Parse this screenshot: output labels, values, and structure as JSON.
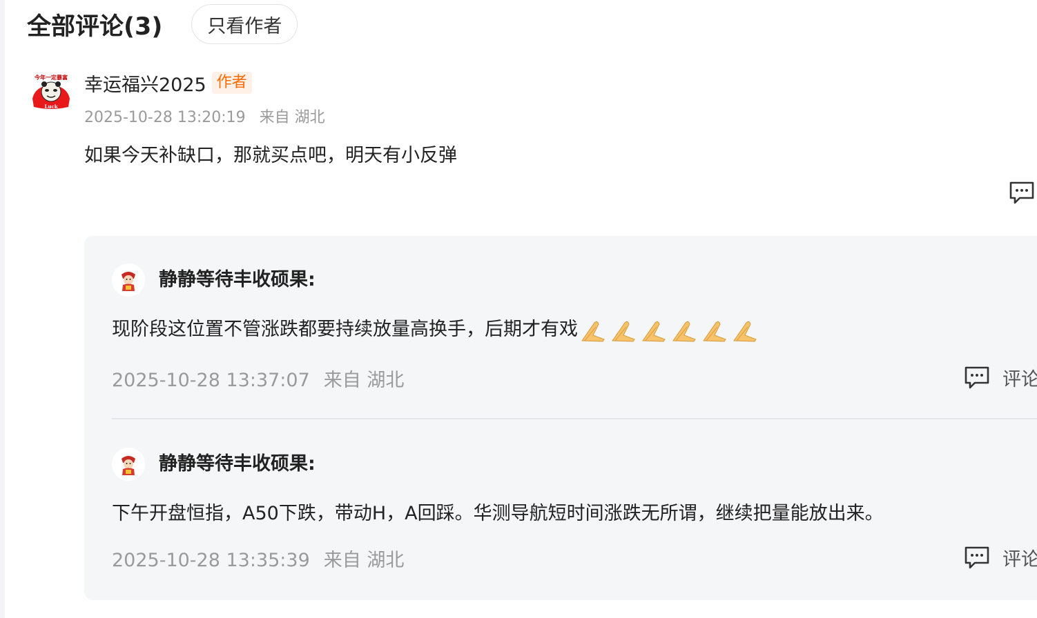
{
  "header": {
    "title": "全部评论(3)",
    "filter_button": "只看作者"
  },
  "main_comment": {
    "username": "幸运福兴2025",
    "badge": "作者",
    "timestamp": "2025-10-28 13:20:19",
    "location": "来自 湖北",
    "text": "如果今天补缺口，那就买点吧，明天有小反弹",
    "avatar_text": "今年一定暴富",
    "avatar_subtext": "Luck"
  },
  "replies": [
    {
      "username": "静静等待丰收硕果:",
      "text": "现阶段这位置不管涨跌都要持续放量高换手，后期才有戏",
      "emoji": "pray-hands-icon",
      "emoji_count": 6,
      "timestamp": "2025-10-28 13:37:07",
      "location": "来自 湖北",
      "action_label": "评论"
    },
    {
      "username": "静静等待丰收硕果:",
      "text": "下午开盘恒指，A50下跌，带动H，A回踩。华测导航短时间涨跌无所谓，继续把量能放出来。",
      "timestamp": "2025-10-28 13:35:39",
      "location": "来自 湖北",
      "action_label": "评论"
    }
  ],
  "colors": {
    "badge_text": "#ff6a00",
    "badge_bg": "#fff1e8",
    "meta_text": "#9a9a9a",
    "reply_bg": "#f5f6f8"
  }
}
